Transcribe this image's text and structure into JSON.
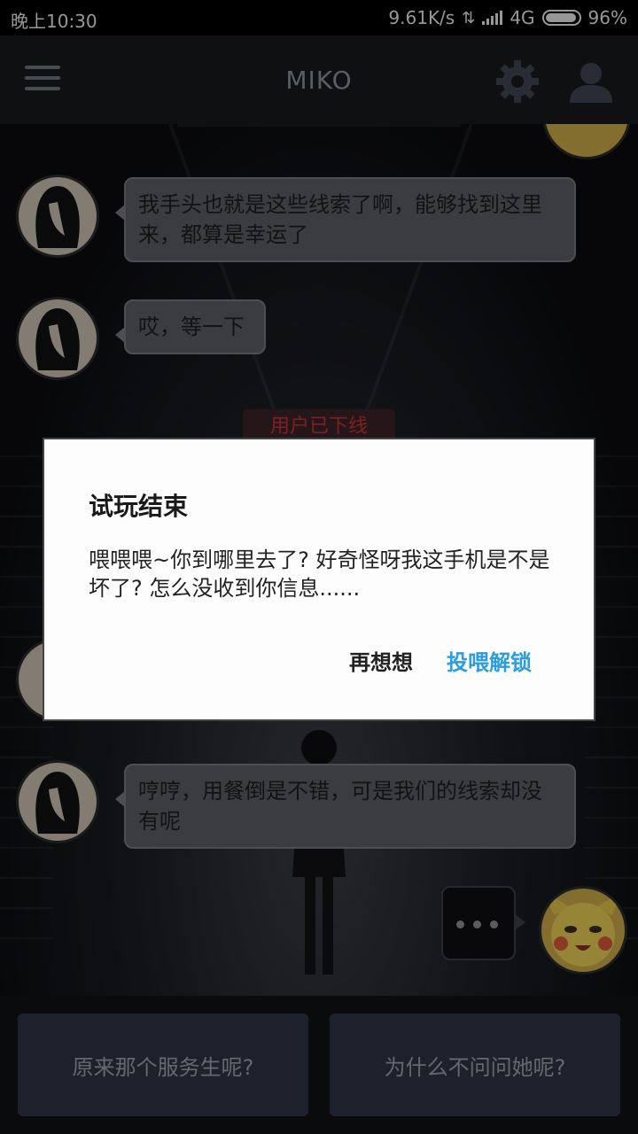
{
  "status_bar": {
    "time": "晚上10:30",
    "net_speed": "9.61K/s",
    "network": "4G",
    "battery": "96%"
  },
  "header": {
    "title": "MIKO",
    "icons": [
      "menu-icon",
      "gear-icon",
      "user-icon"
    ]
  },
  "chat": {
    "messages": [
      {
        "sender": "miko",
        "text": "我手头也就是这些线索了啊，能够找到这里来，都算是幸运了"
      },
      {
        "sender": "miko",
        "text": "哎，等一下"
      },
      {
        "sender": "miko",
        "text": "哼哼，用餐倒是不错，可是我们的线索却没有呢"
      }
    ],
    "system_notice": "用户已下线"
  },
  "choices": [
    {
      "label": "原来那个服务生呢?"
    },
    {
      "label": "为什么不问问她呢?"
    }
  ],
  "dialog": {
    "title": "试玩结束",
    "message": "喂喂喂~你到哪里去了? 好奇怪呀我这手机是不是坏了? 怎么没收到你信息......",
    "cancel_label": "再想想",
    "confirm_label": "投喂解锁",
    "confirm_color": "#2a9de0"
  }
}
